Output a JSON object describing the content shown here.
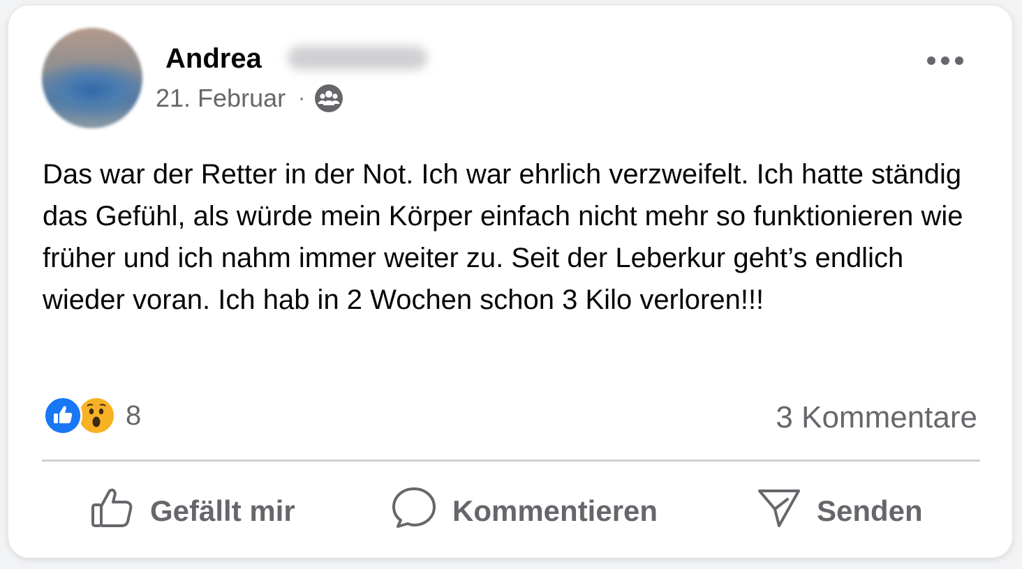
{
  "post": {
    "author_first_name": "Andrea",
    "date": "21. Februar",
    "separator": "·",
    "audience_icon": "group-icon",
    "text": "Das war der Retter in der Not. Ich war ehrlich verzweifelt. Ich hatte ständig das Gefühl, als würde mein Körper einfach nicht mehr so funktionieren wie früher und ich nahm immer weiter zu. Seit der Leberkur geht’s endlich wieder voran. Ich hab in 2 Wochen schon 3 Kilo verloren!!!"
  },
  "reactions": {
    "types": [
      "like-icon",
      "wow-icon"
    ],
    "count": "8"
  },
  "comments": {
    "label": "3 Kommentare"
  },
  "actions": {
    "like_label": "Gefällt mir",
    "comment_label": "Kommentieren",
    "send_label": "Senden"
  },
  "colors": {
    "like_blue": "#1877f2",
    "wow_yellow": "#f7b125",
    "secondary_text": "#65676b",
    "primary_text": "#050505"
  }
}
